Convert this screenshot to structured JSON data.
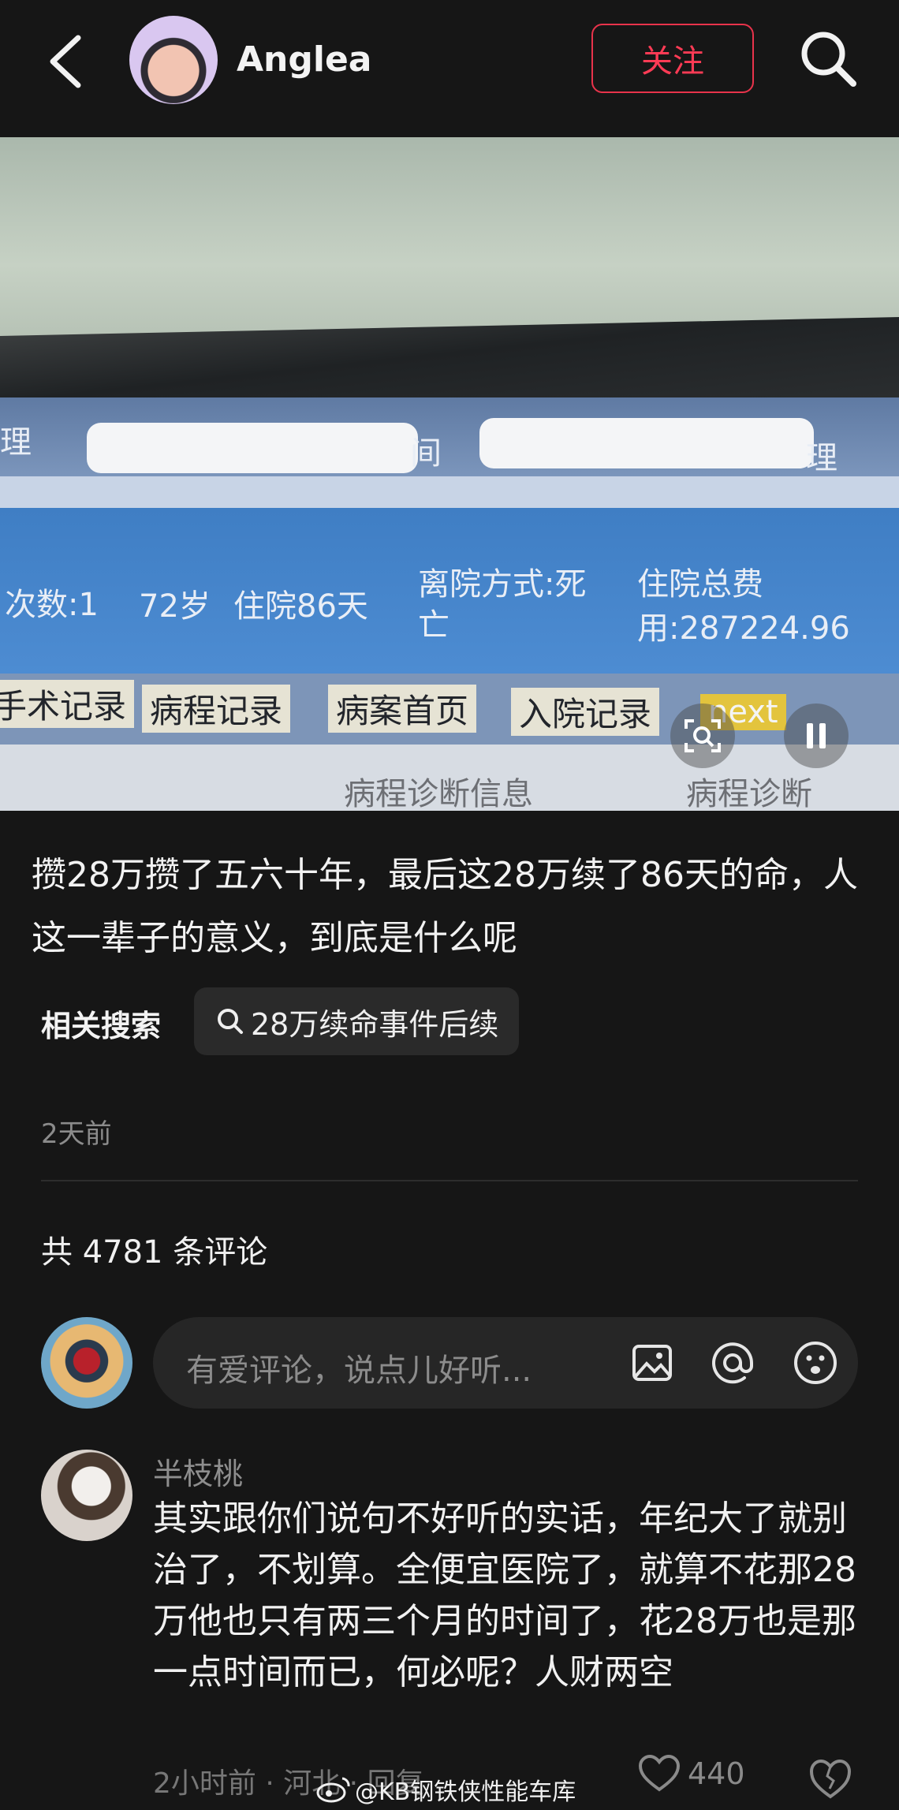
{
  "header": {
    "username": "Anglea",
    "follow_label": "关注"
  },
  "photo": {
    "left_fragment": "理",
    "mid_fragment": "间",
    "right_fragment": "理",
    "visits": "次数:1",
    "age": "72岁",
    "stay": "住院86天",
    "discharge": "离院方式:死",
    "discharge_cont": "亡",
    "cost_label": "住院总费",
    "cost_value": "用:287224.96",
    "tabs": [
      "手术记录",
      "病程记录",
      "病案首页",
      "入院记录"
    ],
    "next_label": "next",
    "bottom_left": "病程诊断信息",
    "bottom_right": "病程诊断"
  },
  "post": {
    "caption": "攒28万攒了五六十年，最后这28万续了86天的命，人这一辈子的意义，到底是什么呢",
    "related_label": "相关搜索",
    "related_query": "28万续命事件后续",
    "time": "2天前"
  },
  "comments": {
    "count_label": "共 4781 条评论",
    "input_placeholder": "有爱评论，说点儿好听...",
    "items": [
      {
        "name": "半枝桃",
        "text": "其实跟你们说句不好听的实话，年纪大了就别治了，不划算。全便宜医院了，就算不花那28万他也只有两三个月的时间了，花28万也是那一点时间而已，何必呢？人财两空",
        "meta": "2小时前 · 河北 · 回复",
        "likes": "440"
      }
    ]
  },
  "watermark": "@KB钢铁侠性能车库",
  "icons": {
    "back": "back-arrow-icon",
    "search": "search-icon",
    "image": "image-icon",
    "mention": "at-icon",
    "emoji": "emoji-icon",
    "like": "heart-icon",
    "dislike": "dislike-heart-icon",
    "weibo": "weibo-icon"
  },
  "colors": {
    "background": "#161616",
    "accent": "#ff3b55",
    "chip": "#2a2a2a"
  }
}
